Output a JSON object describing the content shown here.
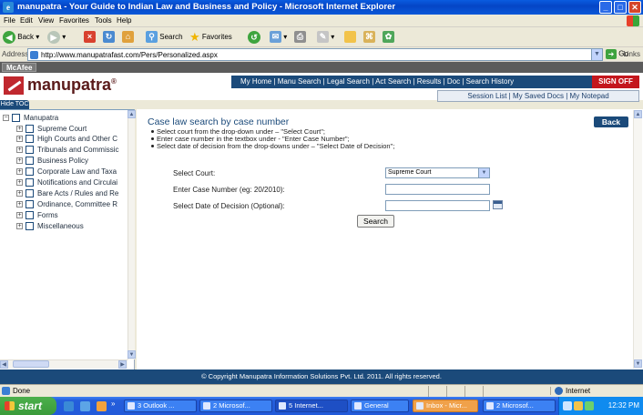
{
  "window": {
    "title": "manupatra - Your Guide to Indian Law and Business and Policy - Microsoft Internet Explorer",
    "minimize": "_",
    "maximize": "□",
    "close": "✕"
  },
  "menu": [
    "File",
    "Edit",
    "View",
    "Favorites",
    "Tools",
    "Help"
  ],
  "toolbar": {
    "back": "Back",
    "search": "Search",
    "favorites": "Favorites"
  },
  "address": {
    "label": "Address",
    "url": "http://www.manupatrafast.com/Pers/Personalized.aspx",
    "go": "Go",
    "links": "Links"
  },
  "mcafee": {
    "label": "McAfee"
  },
  "site": {
    "logo": "manupatra",
    "logo_mark": "®",
    "topnav": "My Home  |  Manu Search  |  Legal Search  |  Act Search  |  Results  |  Doc  |  Search History",
    "signoff": "SIGN OFF",
    "subnav": "Session List  |  My Saved Docs  |  My Notepad",
    "hide_toc": "Hide TOC"
  },
  "toc": {
    "root": "Manupatra",
    "items": [
      "Supreme Court",
      "High Courts and Other C",
      "Tribunals and Commissic",
      "Business Policy",
      "Corporate Law and Taxa",
      "Notifications and Circulai",
      "Bare Acts / Rules and Re",
      "Ordinance, Committee R",
      "Forms",
      "Miscellaneous"
    ]
  },
  "main": {
    "title": "Case law search by case number",
    "back": "Back",
    "instructions": [
      "Select court from the drop-down under – \"Select Court\";",
      "Enter case number in the textbox under - \"Enter Case Number\";",
      "Select date of decision from the drop-downs under – \"Select Date of Decision\";"
    ],
    "form": {
      "court_label": "Select Court:",
      "court_value": "Supreme Court",
      "case_label": "Enter Case Number (eg: 20/2010):",
      "case_value": "",
      "date_label": "Select Date of Decision (Optional):",
      "date_value": "",
      "search_button": "Search"
    }
  },
  "footer": "© Copyright Manupatra Information Solutions Pvt. Ltd. 2011. All rights reserved.",
  "status": {
    "text": "Done",
    "zone": "Internet"
  },
  "taskbar": {
    "start": "start",
    "tasks": [
      "3 Outlook ...",
      "2 Microsof...",
      "5 Internet...",
      "General",
      "Inbox - Micr...",
      "2 Microsof..."
    ],
    "clock": "12:32 PM"
  }
}
